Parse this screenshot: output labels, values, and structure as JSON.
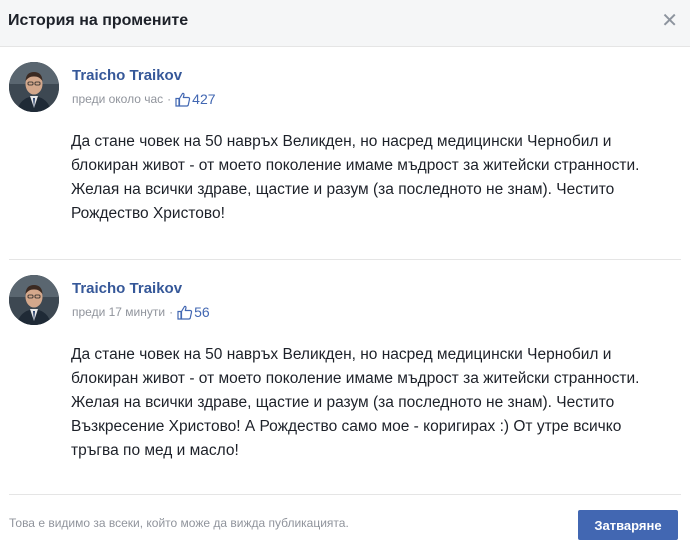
{
  "dialog": {
    "title": "История на промените",
    "close_icon": "close-icon"
  },
  "posts": [
    {
      "author": "Traicho Traikov",
      "time": "преди около час",
      "separator": "·",
      "likes": "427",
      "text": "Да стане човек на 50 навръх Великден, но насред медицински Чернобил и блокиран живот - от моето поколение имаме мъдрост за житейски странности. Желая на всички здраве, щастие и разум (за последното не знам). Честито Рождество Христово!"
    },
    {
      "author": "Traicho Traikov",
      "time": "преди 17 минути",
      "separator": "·",
      "likes": "56",
      "text": "Да стане човек на 50 навръх Великден, но насред медицински Чернобил и блокиран живот - от моето поколение имаме мъдрост за житейски странности. Желая на всички здраве, щастие и разум (за последното не знам). Честито Възкресение Христово! А Рождество само мое - коригирах :) От утре всичко тръгва по мед и масло!"
    }
  ],
  "footer": {
    "visibility_text": "Това е видимо за всеки, който може да вижда публикацията.",
    "close_button": "Затваряне"
  },
  "colors": {
    "accent": "#4267b2",
    "author_link": "#365899",
    "header_bg": "#f5f6f7"
  }
}
